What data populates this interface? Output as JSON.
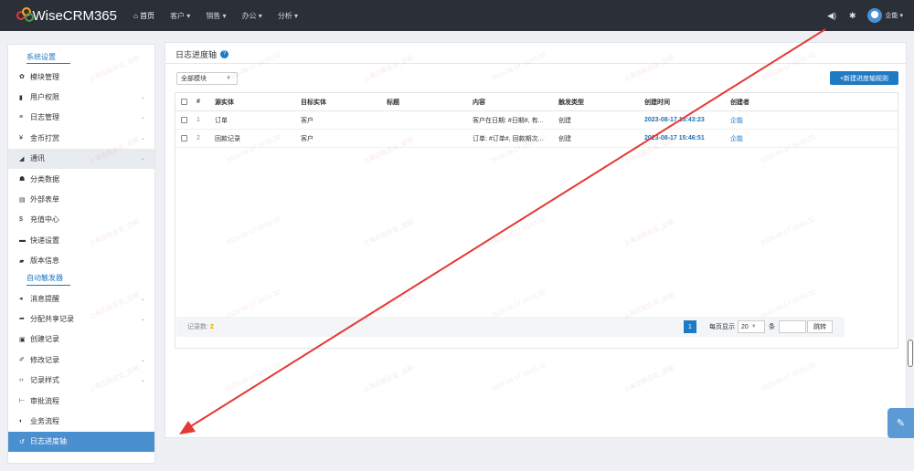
{
  "app": {
    "logo_text": "WiseCRM365"
  },
  "topnav": {
    "items": [
      {
        "label": "首页",
        "icon": "home-icon"
      },
      {
        "label": "客户"
      },
      {
        "label": "销售"
      },
      {
        "label": "办公"
      },
      {
        "label": "分析"
      }
    ],
    "user_name": "企能"
  },
  "sidebar": {
    "section1": "系统设置",
    "items1": [
      {
        "label": "模块管理",
        "icon": "gear-icon",
        "chevron": false
      },
      {
        "label": "用户权限",
        "icon": "lock-icon",
        "chevron": true
      },
      {
        "label": "日志管理",
        "icon": "list-icon",
        "chevron": true
      },
      {
        "label": "金币打赏",
        "icon": "yen-icon",
        "chevron": true
      },
      {
        "label": "通讯",
        "icon": "send-icon",
        "chevron": true,
        "highlight": true
      },
      {
        "label": "分类数据",
        "icon": "sitemap-icon",
        "chevron": false
      },
      {
        "label": "外部表单",
        "icon": "form-icon",
        "chevron": false
      },
      {
        "label": "充值中心",
        "icon": "dollar-icon",
        "chevron": false
      },
      {
        "label": "快递设置",
        "icon": "truck-icon",
        "chevron": false
      },
      {
        "label": "版本信息",
        "icon": "book-icon",
        "chevron": false
      }
    ],
    "section2": "自动触发器",
    "items2": [
      {
        "label": "消息提醒",
        "icon": "bell-icon",
        "chevron": true
      },
      {
        "label": "分配共享记录",
        "icon": "share-icon",
        "chevron": true
      },
      {
        "label": "创建记录",
        "icon": "plus-square-icon",
        "chevron": false
      },
      {
        "label": "修改记录",
        "icon": "pencil-icon",
        "chevron": true
      },
      {
        "label": "记录样式",
        "icon": "code-icon",
        "chevron": true
      },
      {
        "label": "审批流程",
        "icon": "flow-icon",
        "chevron": false
      },
      {
        "label": "业务流程",
        "icon": "shield-icon",
        "chevron": false
      },
      {
        "label": "日志进度轴",
        "icon": "history-icon",
        "chevron": false,
        "active": true
      }
    ]
  },
  "main": {
    "title": "日志进度轴",
    "module_select": "全部模块",
    "new_button": "+新建进度轴规则",
    "columns": [
      "#",
      "源实体",
      "目标实体",
      "标题",
      "内容",
      "触发类型",
      "创建时间",
      "创建者"
    ],
    "rows": [
      {
        "num": "1",
        "source": "订单",
        "target": "客户",
        "title": "",
        "content": "客户在日期: #日期#, 有...",
        "trigger": "创建",
        "created": "2023-08-17 15:43:23",
        "creator": "企能"
      },
      {
        "num": "2",
        "source": "回款记录",
        "target": "客户",
        "title": "",
        "content": "订单: #订单#, 回款期次...",
        "trigger": "创建",
        "created": "2023-08-17 15:46:51",
        "creator": "企能"
      }
    ],
    "footer": {
      "record_label": "记录数:",
      "record_count": "2",
      "current_page": "1",
      "per_page_label": "每页显示",
      "page_size": "20",
      "unit": "条",
      "jump_label": "跳转"
    }
  },
  "watermark": {
    "company": "上海企能企业_企能",
    "time": "2023-08-17 16:01:32"
  },
  "colors": {
    "accent": "#1f7ac4",
    "topbar": "#2b2f38",
    "annotation_arrow": "#e53935"
  }
}
